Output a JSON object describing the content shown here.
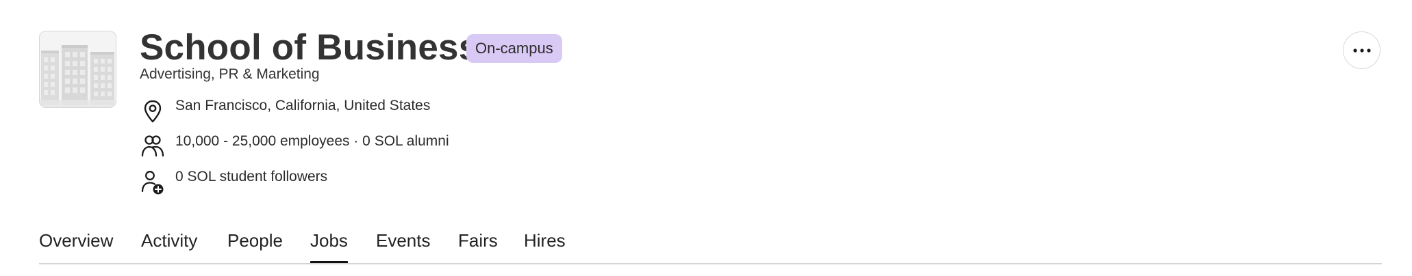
{
  "header": {
    "title": "School of Business",
    "badge": "On-campus",
    "subtitle": "Advertising, PR & Marketing",
    "logo_icon": "office-buildings-icon",
    "badge_color": "#d9c9f5"
  },
  "info": {
    "location": "San Francisco, California, United States",
    "employees": "10,000 - 25,000 employees · 0 SOL alumni",
    "followers": "0 SOL student followers",
    "location_icon": "map-pin-icon",
    "employees_icon": "people-icon",
    "followers_icon": "person-plus-icon"
  },
  "actions": {
    "more_icon": "ellipsis-icon",
    "more_glyph": "···"
  },
  "tabs": [
    {
      "label": "Overview",
      "active": false
    },
    {
      "label": "Activity",
      "active": false
    },
    {
      "label": "People",
      "active": false
    },
    {
      "label": "Jobs",
      "active": true
    },
    {
      "label": "Events",
      "active": false
    },
    {
      "label": "Fairs",
      "active": false
    },
    {
      "label": "Hires",
      "active": false
    }
  ]
}
